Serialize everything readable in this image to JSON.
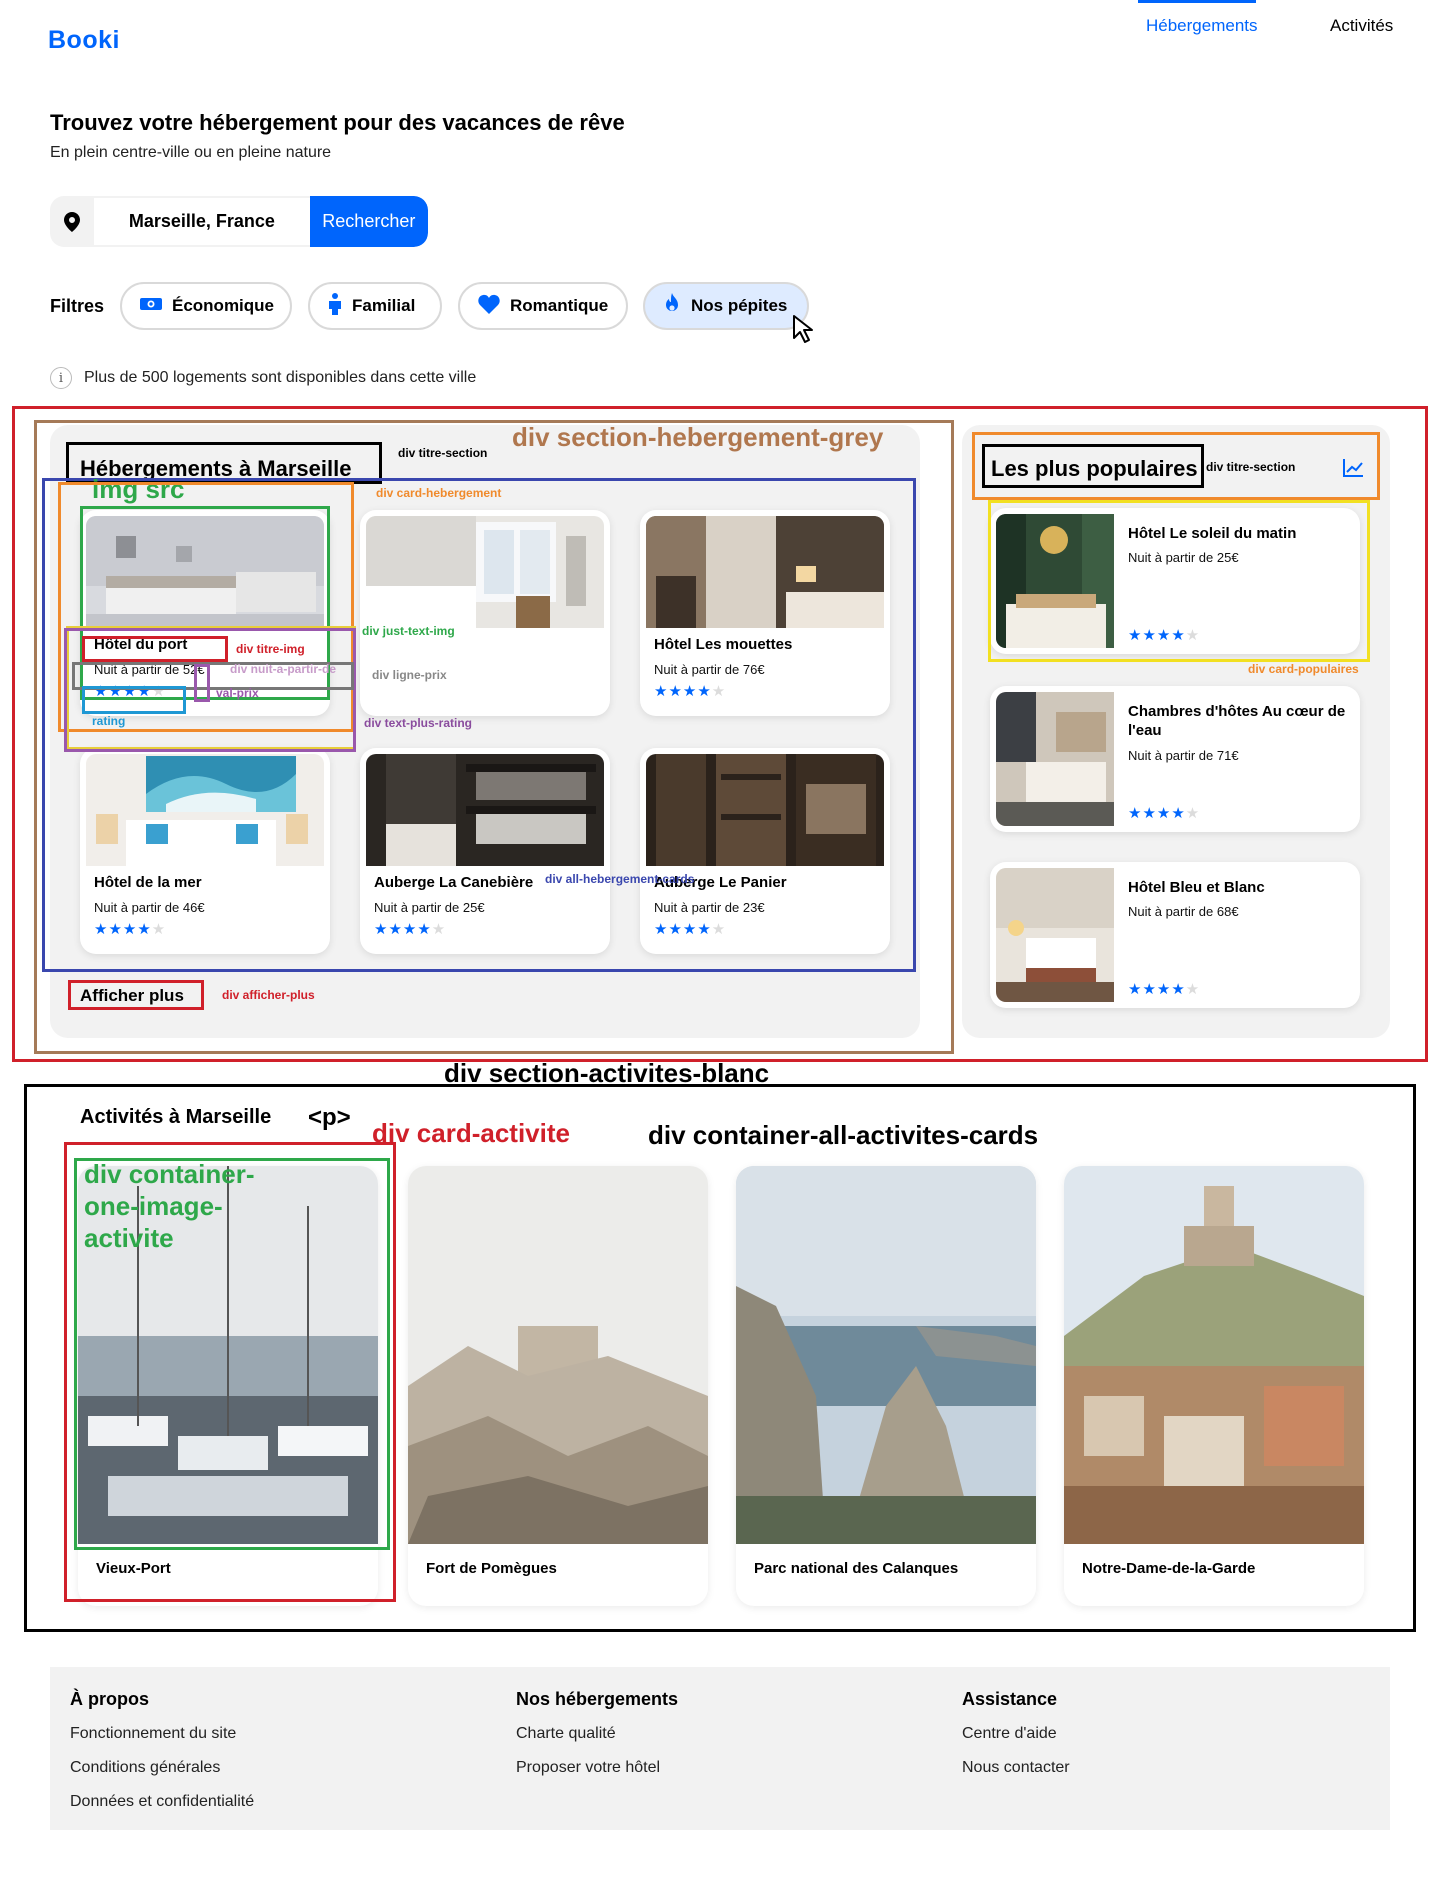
{
  "header": {
    "logo": "Booki",
    "nav": [
      {
        "label": "Hébergements",
        "active": true
      },
      {
        "label": "Activités",
        "active": false
      }
    ]
  },
  "hero": {
    "title": "Trouvez votre hébergement pour des vacances de rêve",
    "subtitle": "En plein centre-ville ou en pleine nature"
  },
  "search": {
    "icon": "location-pin-icon",
    "value": "Marseille, France",
    "button": "Rechercher"
  },
  "filters": {
    "label": "Filtres",
    "chips": [
      {
        "label": "Économique",
        "icon": "money-icon",
        "selected": false
      },
      {
        "label": "Familial",
        "icon": "person-icon",
        "selected": false
      },
      {
        "label": "Romantique",
        "icon": "heart-icon",
        "selected": false
      },
      {
        "label": "Nos pépites",
        "icon": "flame-icon",
        "selected": true
      }
    ]
  },
  "info": {
    "text": "Plus de 500 logements sont disponibles dans cette ville"
  },
  "hebergements": {
    "title": "Hébergements à Marseille",
    "more": "Afficher plus",
    "cards": [
      {
        "name": "Hôtel du port",
        "price_prefix": "Nuit à partir de ",
        "price": "52€",
        "rating": 4
      },
      {
        "name": "",
        "price_prefix": "",
        "price": "",
        "rating": 0
      },
      {
        "name": "Hôtel Les mouettes",
        "price_prefix": "Nuit à partir de ",
        "price": "76€",
        "rating": 4
      },
      {
        "name": "Hôtel de la mer",
        "price_prefix": "Nuit à partir de ",
        "price": "46€",
        "rating": 4
      },
      {
        "name": "Auberge La Canebière",
        "price_prefix": "Nuit à partir de ",
        "price": "25€",
        "rating": 4
      },
      {
        "name": "Auberge Le Panier",
        "price_prefix": "Nuit à partir de ",
        "price": "23€",
        "rating": 4
      }
    ]
  },
  "populaires": {
    "title": "Les plus populaires",
    "icon": "trending-chart-icon",
    "cards": [
      {
        "name": "Hôtel Le soleil du matin",
        "price": "Nuit à partir de 25€",
        "rating": 4
      },
      {
        "name": "Chambres d'hôtes Au cœur de l'eau",
        "price": "Nuit à partir de 71€",
        "rating": 4
      },
      {
        "name": "Hôtel Bleu et Blanc",
        "price": "Nuit à partir de 68€",
        "rating": 4
      }
    ]
  },
  "activites": {
    "title": "Activités à Marseille",
    "cards": [
      {
        "name": "Vieux-Port"
      },
      {
        "name": "Fort de Pomègues"
      },
      {
        "name": "Parc national des Calanques"
      },
      {
        "name": "Notre-Dame-de-la-Garde"
      }
    ]
  },
  "footer": {
    "columns": [
      {
        "title": "À propos",
        "links": [
          "Fonctionnement du site",
          "Conditions générales",
          "Données et confidentialité"
        ]
      },
      {
        "title": "Nos hébergements",
        "links": [
          "Charte qualité",
          "Proposer votre hôtel"
        ]
      },
      {
        "title": "Assistance",
        "links": [
          "Centre d'aide",
          "Nous contacter"
        ]
      }
    ]
  },
  "annotations": {
    "section_hebergement_grey": "div section-hebergement-grey",
    "titre_section": "div titre-section",
    "img_src": "img src",
    "card_hebergement": "div card-hebergement",
    "just_text_img": "div just-text-img",
    "titre_img": "div titre-img",
    "nuit_a_partir_de": "div nuit-a-partir-de",
    "ligne_prix": "div ligne-prix",
    "val_prix": "val-prix",
    "rating": "rating",
    "text_plus_rating": "div text-plus-rating",
    "all_hebergement_cards": "div all-hebergement-cards",
    "afficher_plus": "div afficher-plus",
    "titre_section_2": "div titre-section",
    "card_populaires": "div card-populaires",
    "section_activites_blanc": "div section-activites-blanc",
    "p_tag": "<p>",
    "card_activite": "div card-activite",
    "container_all_activites_cards": "div container-all-activites-cards",
    "container_one_image_activite": "div container-one-image-activite"
  },
  "colors": {
    "brand": "#0065FC",
    "grey_bg": "#F2F2F2",
    "chip_selected": "#DEEBFF"
  }
}
